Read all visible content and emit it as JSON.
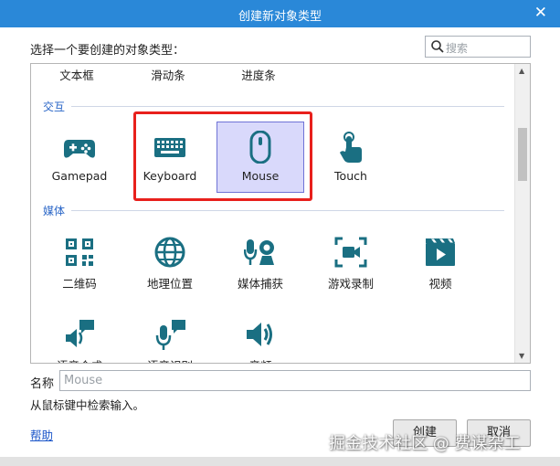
{
  "window": {
    "title": "创建新对象类型",
    "close_glyph": "✕"
  },
  "prompt": "选择一个要创建的对象类型：",
  "search": {
    "placeholder": "搜索"
  },
  "list": {
    "partial_row": [
      "文本框",
      "滑动条",
      "进度条"
    ],
    "categories": [
      {
        "name": "交互",
        "items": [
          {
            "label": "Gamepad",
            "icon": "gamepad-icon"
          },
          {
            "label": "Keyboard",
            "icon": "keyboard-icon"
          },
          {
            "label": "Mouse",
            "icon": "mouse-icon",
            "selected": true
          },
          {
            "label": "Touch",
            "icon": "touch-icon"
          }
        ]
      },
      {
        "name": "媒体",
        "items": [
          {
            "label": "二维码",
            "icon": "qr-code-icon"
          },
          {
            "label": "地理位置",
            "icon": "globe-icon"
          },
          {
            "label": "媒体捕获",
            "icon": "media-capture-icon"
          },
          {
            "label": "游戏录制",
            "icon": "video-record-icon"
          },
          {
            "label": "视频",
            "icon": "video-icon"
          },
          {
            "label": "语音合成",
            "icon": "speech-synthesis-icon"
          },
          {
            "label": "语音识别",
            "icon": "speech-recognition-icon"
          },
          {
            "label": "音频",
            "icon": "audio-icon"
          }
        ]
      }
    ]
  },
  "name_field": {
    "label": "名称",
    "placeholder": "Mouse"
  },
  "hint": "从鼠标键中检索输入。",
  "help_link": "帮助",
  "buttons": {
    "create": "创建",
    "cancel": "取消"
  },
  "watermark": "掘金技术社区 @ 费谋杂工",
  "colors": {
    "titlebar": "#2a88d8",
    "icon_teal": "#1a6f82",
    "selection": "#d9d9fb",
    "category": "#2a66c7",
    "highlight_box": "#e8201c"
  }
}
